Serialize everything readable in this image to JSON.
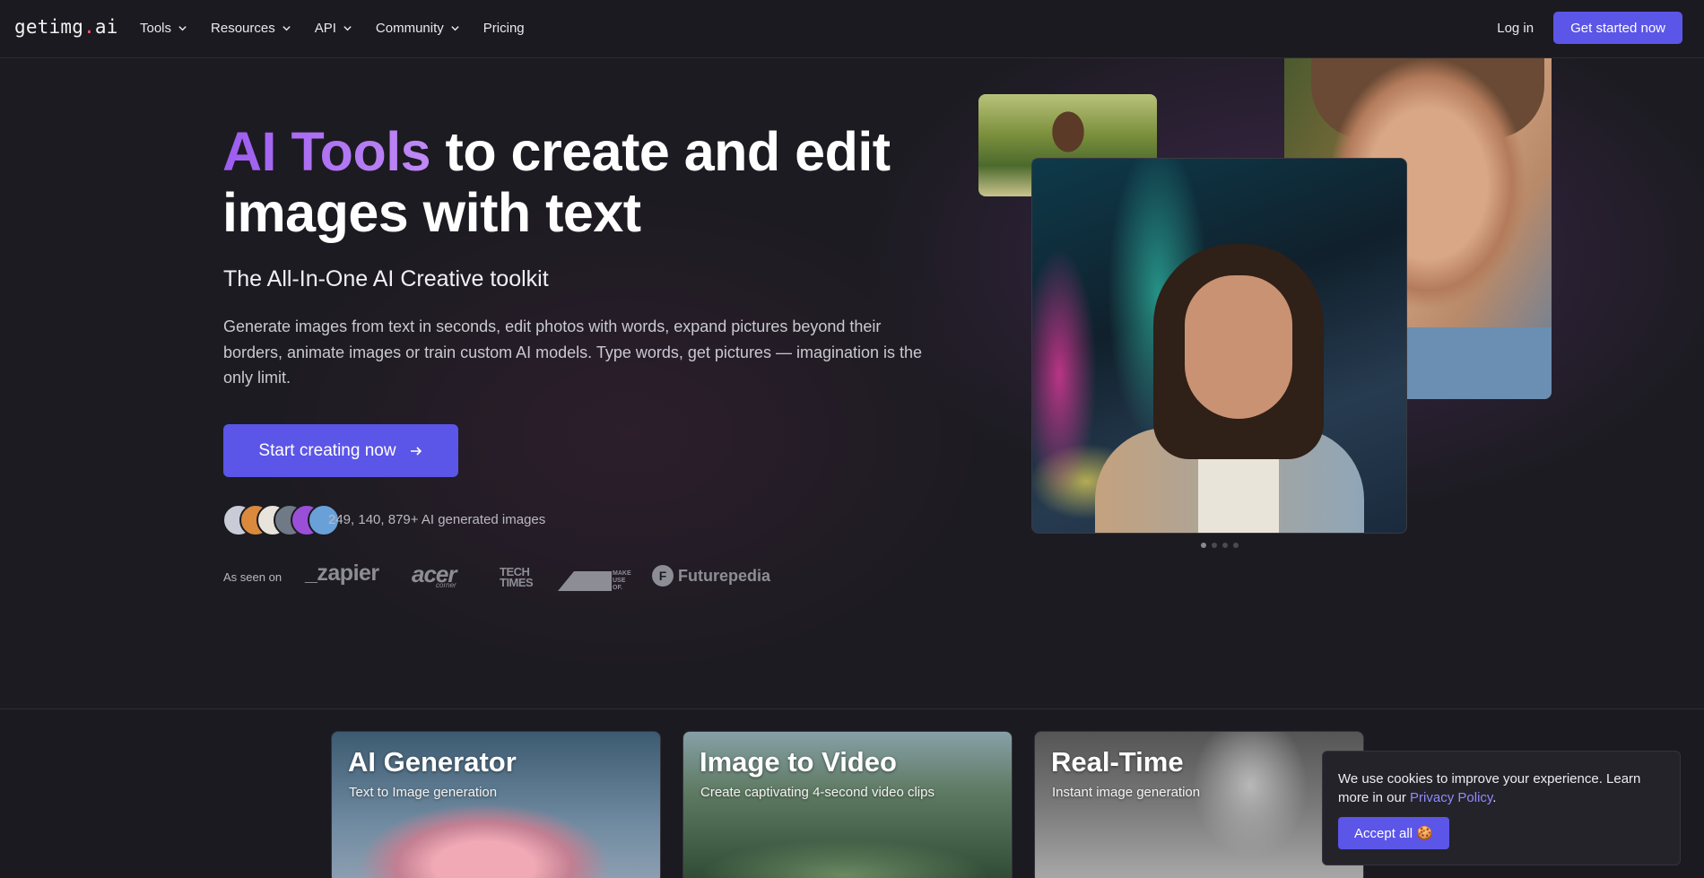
{
  "nav": {
    "logo_main": "getimg",
    "logo_dot": ".",
    "logo_tld": "ai",
    "items": [
      {
        "label": "Tools",
        "dropdown": true
      },
      {
        "label": "Resources",
        "dropdown": true
      },
      {
        "label": "API",
        "dropdown": true
      },
      {
        "label": "Community",
        "dropdown": true
      },
      {
        "label": "Pricing",
        "dropdown": false
      }
    ],
    "login": "Log in",
    "get_started": "Get started now"
  },
  "hero": {
    "title_highlight": "AI Tools",
    "title_rest": " to create and edit images with text",
    "subtitle": "The All-In-One AI Creative toolkit",
    "description": "Generate images from text in seconds, edit photos with words, expand pictures beyond their borders, animate images or train custom AI models. Type words, get pictures — imagination is the only limit.",
    "cta": "Start creating now",
    "image_count": "249, 140, 879+ AI generated images",
    "as_seen_on": "As seen on",
    "press": {
      "zapier": "_zapier",
      "acer": "acer",
      "acer_sub": "corner",
      "tech_line1": "TECH",
      "tech_line2": "TIMES",
      "muo_line1": "MAKE",
      "muo_line2": "USE",
      "muo_line3": "OF.",
      "futurepedia": "Futurepedia",
      "futurepedia_mark": "F"
    },
    "avatar_colors": [
      "#c9ccd6",
      "#d98a3c",
      "#e8e4dc",
      "#6f7a86",
      "#9a4fd8",
      "#6aa0d8"
    ]
  },
  "carousel": {
    "slides": 4,
    "active": 0
  },
  "cards": [
    {
      "title": "AI Generator",
      "subtitle": "Text to Image generation"
    },
    {
      "title": "Image to Video",
      "subtitle": "Create captivating 4-second video clips"
    },
    {
      "title": "Real-Time",
      "subtitle": "Instant image generation"
    }
  ],
  "cookie": {
    "text": "We use cookies to improve your experience. Learn more in our ",
    "link": "Privacy Policy",
    "period": ".",
    "accept": "Accept all 🍪"
  },
  "colors": {
    "accent": "#5b55e8",
    "title_gradient_start": "#9d5cf0",
    "background": "#1b1a20"
  }
}
